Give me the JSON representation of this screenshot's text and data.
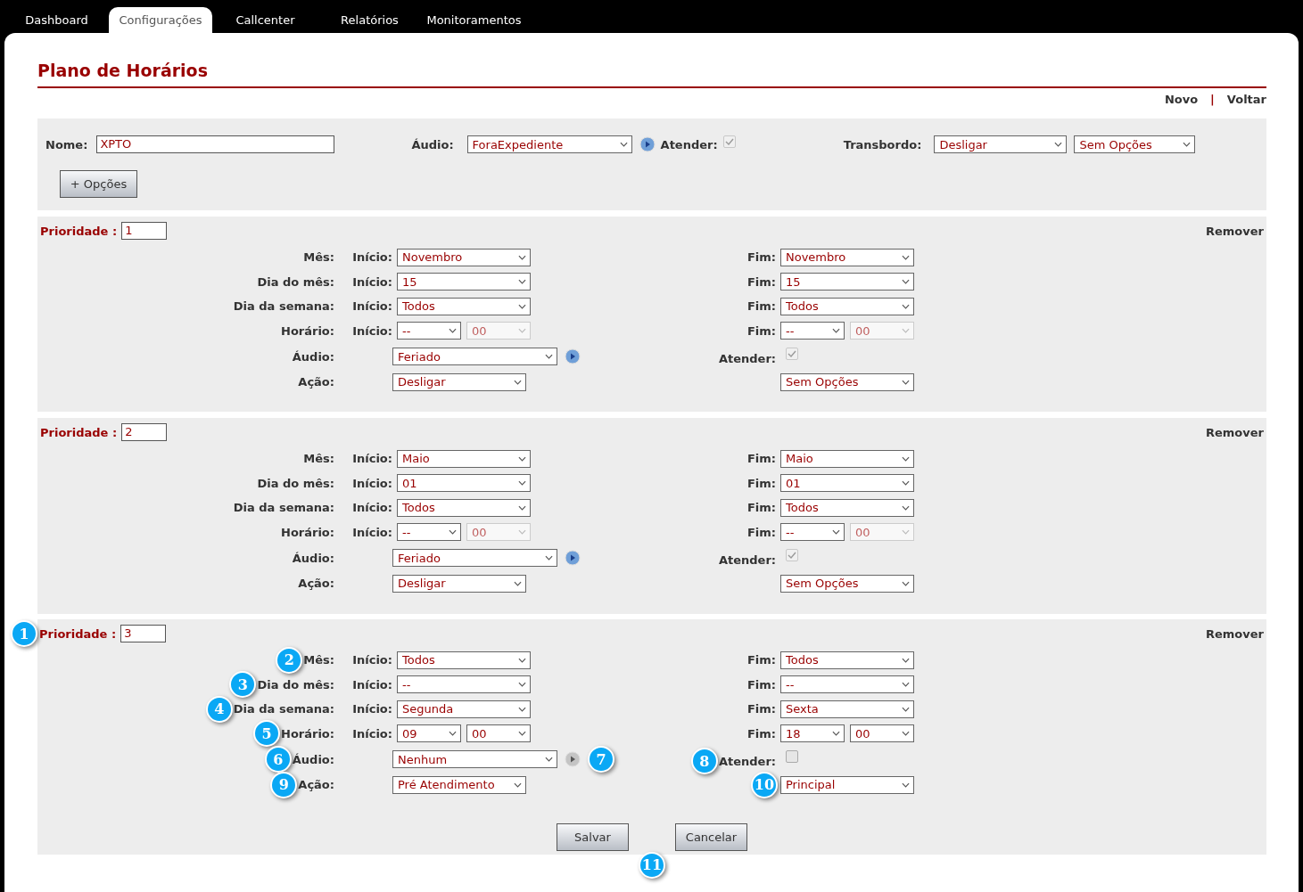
{
  "nav": {
    "tabs": [
      {
        "label": "Dashboard",
        "selected": false
      },
      {
        "label": "Configurações",
        "selected": true
      },
      {
        "label": "Callcenter",
        "selected": false
      },
      {
        "label": "Relatórios",
        "selected": false
      },
      {
        "label": "Monitoramentos",
        "selected": false
      }
    ]
  },
  "page": {
    "title": "Plano de Horários",
    "links": [
      "Novo",
      "Voltar"
    ],
    "separator": "|"
  },
  "header_form": {
    "name_label": "Nome:",
    "name_value": "XPTO",
    "audio_label": "Áudio:",
    "audio_value": "ForaExpediente",
    "play_active": true,
    "atender_label": "Atender:",
    "atender_checked": true,
    "atender_disabled": true,
    "transbordo_label": "Transbordo:",
    "transbordo_values": [
      "Desligar",
      "Sem Opções"
    ],
    "options_button": "+ Opções"
  },
  "priorities": [
    {
      "label": "Prioridade :",
      "value": "1",
      "remove": "Remover",
      "rows": [
        {
          "label": "Mês:",
          "start_label": "Início:",
          "start": [
            {
              "value": "Novembro",
              "disabled": false
            }
          ],
          "end_label": "Fim:",
          "end": [
            {
              "value": "Novembro",
              "disabled": false
            }
          ]
        },
        {
          "label": "Dia do mês:",
          "start_label": "Início:",
          "start": [
            {
              "value": "15",
              "disabled": false
            }
          ],
          "end_label": "Fim:",
          "end": [
            {
              "value": "15",
              "disabled": false
            }
          ]
        },
        {
          "label": "Dia da semana:",
          "start_label": "Início:",
          "start": [
            {
              "value": "Todos",
              "disabled": false
            }
          ],
          "end_label": "Fim:",
          "end": [
            {
              "value": "Todos",
              "disabled": false
            }
          ]
        },
        {
          "label": "Horário:",
          "start_label": "Início:",
          "start": [
            {
              "value": "--",
              "disabled": false
            },
            {
              "value": "00",
              "disabled": true
            }
          ],
          "end_label": "Fim:",
          "end": [
            {
              "value": "--",
              "disabled": false
            },
            {
              "value": "00",
              "disabled": true
            }
          ]
        }
      ],
      "audio": {
        "label": "Áudio:",
        "value": "Feriado",
        "play_active": true
      },
      "atender": {
        "label": "Atender:",
        "checked": true,
        "disabled": true
      },
      "action": {
        "label": "Ação:",
        "value": "Desligar",
        "second_value": "Sem Opções"
      }
    },
    {
      "label": "Prioridade :",
      "value": "2",
      "remove": "Remover",
      "rows": [
        {
          "label": "Mês:",
          "start_label": "Início:",
          "start": [
            {
              "value": "Maio",
              "disabled": false
            }
          ],
          "end_label": "Fim:",
          "end": [
            {
              "value": "Maio",
              "disabled": false
            }
          ]
        },
        {
          "label": "Dia do mês:",
          "start_label": "Início:",
          "start": [
            {
              "value": "01",
              "disabled": false
            }
          ],
          "end_label": "Fim:",
          "end": [
            {
              "value": "01",
              "disabled": false
            }
          ]
        },
        {
          "label": "Dia da semana:",
          "start_label": "Início:",
          "start": [
            {
              "value": "Todos",
              "disabled": false
            }
          ],
          "end_label": "Fim:",
          "end": [
            {
              "value": "Todos",
              "disabled": false
            }
          ]
        },
        {
          "label": "Horário:",
          "start_label": "Início:",
          "start": [
            {
              "value": "--",
              "disabled": false
            },
            {
              "value": "00",
              "disabled": true
            }
          ],
          "end_label": "Fim:",
          "end": [
            {
              "value": "--",
              "disabled": false
            },
            {
              "value": "00",
              "disabled": true
            }
          ]
        }
      ],
      "audio": {
        "label": "Áudio:",
        "value": "Feriado",
        "play_active": true
      },
      "atender": {
        "label": "Atender:",
        "checked": true,
        "disabled": true
      },
      "action": {
        "label": "Ação:",
        "value": "Desligar",
        "second_value": "Sem Opções"
      }
    },
    {
      "label": "Prioridade :",
      "value": "3",
      "remove": "Remover",
      "callout": "1",
      "rows": [
        {
          "label": "Mês:",
          "callout": "2",
          "start_label": "Início:",
          "start": [
            {
              "value": "Todos",
              "disabled": false
            }
          ],
          "end_label": "Fim:",
          "end": [
            {
              "value": "Todos",
              "disabled": false
            }
          ]
        },
        {
          "label": "Dia do mês:",
          "callout": "3",
          "start_label": "Início:",
          "start": [
            {
              "value": "--",
              "disabled": false
            }
          ],
          "end_label": "Fim:",
          "end": [
            {
              "value": "--",
              "disabled": false
            }
          ]
        },
        {
          "label": "Dia da semana:",
          "callout": "4",
          "start_label": "Início:",
          "start": [
            {
              "value": "Segunda",
              "disabled": false
            }
          ],
          "end_label": "Fim:",
          "end": [
            {
              "value": "Sexta",
              "disabled": false
            }
          ]
        },
        {
          "label": "Horário:",
          "callout": "5",
          "start_label": "Início:",
          "start": [
            {
              "value": "09",
              "disabled": false
            },
            {
              "value": "00",
              "disabled": false
            }
          ],
          "end_label": "Fim:",
          "end": [
            {
              "value": "18",
              "disabled": false
            },
            {
              "value": "00",
              "disabled": false
            }
          ]
        }
      ],
      "audio": {
        "label": "Áudio:",
        "callout": "6",
        "value": "Nenhum",
        "play_active": false,
        "play_callout": "7"
      },
      "atender": {
        "label": "Atender:",
        "checked": false,
        "disabled": false,
        "callout": "8"
      },
      "action": {
        "label": "Ação:",
        "callout": "9",
        "value": "Pré Atendimento",
        "second_value": "Principal",
        "second_callout": "10"
      },
      "buttons": {
        "save": "Salvar",
        "cancel": "Cancelar",
        "callout": "11"
      }
    }
  ]
}
